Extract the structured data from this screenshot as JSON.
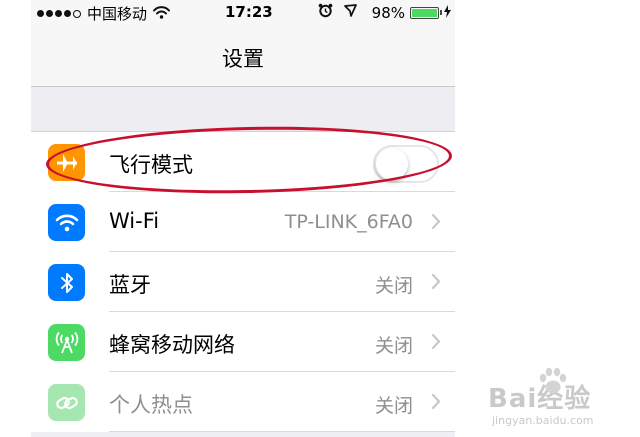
{
  "status_bar": {
    "carrier": "中国移动",
    "time": "17:23",
    "battery": "98%",
    "battery_level": 0.98,
    "icons": [
      "signal-dots",
      "wifi",
      "alarm-clock",
      "location-arrow",
      "battery",
      "charging-bolt"
    ]
  },
  "nav": {
    "title": "设置"
  },
  "settings": [
    {
      "label": "飞行模式",
      "icon": "airplane",
      "icon_color": "#ff9500",
      "control": "toggle",
      "toggle_on": false
    },
    {
      "label": "Wi-Fi",
      "icon": "wifi",
      "icon_color": "#007aff",
      "value": "TP-LINK_6FA0"
    },
    {
      "label": "蓝牙",
      "icon": "bluetooth",
      "icon_color": "#007aff",
      "value": "关闭"
    },
    {
      "label": "蜂窝移动网络",
      "icon": "cellular-antenna",
      "icon_color": "#4cd964",
      "value": "关闭"
    },
    {
      "label": "个人热点",
      "icon": "personal-hotspot",
      "icon_color": "#a6e6b0",
      "value": "关闭"
    }
  ],
  "annotation": {
    "color": "#c8102e",
    "shape": "ellipse",
    "target": "飞行模式"
  },
  "watermark": {
    "main": "Bai经验",
    "sub": "jingyan.baidu.com",
    "color": "#c9c9c9"
  }
}
